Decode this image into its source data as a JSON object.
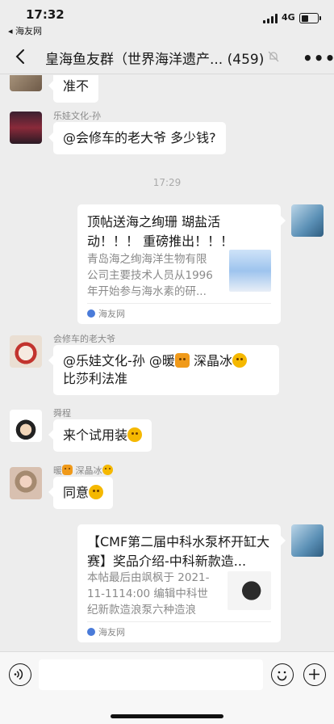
{
  "status_bar": {
    "time": "17:32",
    "back_app": "◂ 海友网",
    "network": "4G",
    "battery_level": 0.45
  },
  "nav": {
    "title": "皇海鱼友群（世界海洋遗产... (459)",
    "more": "•••"
  },
  "messages": [
    {
      "type": "text",
      "side": "left",
      "text": "准不"
    },
    {
      "type": "text",
      "side": "left",
      "sender": "乐娃文化-孙",
      "text": "@会修车的老大爷 多少钱?"
    },
    {
      "type": "time",
      "text": "17:29"
    },
    {
      "type": "card",
      "side": "right",
      "title": "顶帖送海之绚珊 瑚盐活动！！！ 重磅推出！！！",
      "desc": "青岛海之绚海洋生物有限公司主要技术人员从1996年开始参与海水素的研...",
      "source": "海友网"
    },
    {
      "type": "text",
      "side": "left",
      "sender": "会修车的老大爷",
      "parts": [
        "@乐娃文化-孙 @暖",
        "深晶冰",
        "比莎利法准"
      ]
    },
    {
      "type": "text",
      "side": "left",
      "sender": "舜程",
      "text": "来个试用装"
    },
    {
      "type": "text",
      "side": "left",
      "sender_parts": [
        "暖",
        "深晶冰"
      ],
      "text": "同意"
    },
    {
      "type": "card",
      "side": "right",
      "title": "【CMF第二届中科水泵杯开缸大赛】奖品介绍-中科新款造...",
      "desc": "本帖最后由飒枫于 2021-11-1114:00 编辑中科世纪新款造浪泵六种造浪模...",
      "source": "海友网"
    }
  ],
  "colors": {
    "background": "#ededed",
    "bubble": "#ffffff",
    "link_source": "#4a7bd9"
  }
}
